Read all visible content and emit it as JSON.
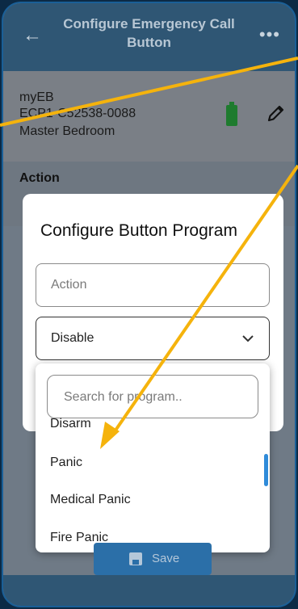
{
  "header": {
    "title": "Configure Emergency Call Button",
    "back_icon": "arrow-left-icon",
    "menu_icon": "more-dots-icon"
  },
  "device": {
    "name": "myEB",
    "serial": "ECP1-C52538-0088",
    "location": "Master Bedroom",
    "battery_icon": "battery-full-icon",
    "edit_icon": "pencil-icon"
  },
  "section": {
    "action_label": "Action"
  },
  "modal": {
    "title": "Configure Button Program",
    "action_placeholder": "Action",
    "selected_value": "Disable"
  },
  "dropdown": {
    "search_placeholder": "Search for program..",
    "options": [
      "Disarm",
      "Panic",
      "Medical Panic",
      "Fire Panic"
    ]
  },
  "footer": {
    "save_label": "Save"
  },
  "colors": {
    "header_bg": "#2f5674",
    "accent_blue": "#2f8bd9",
    "annotation_arrow": "#f5b30c",
    "battery_green": "#1e7b2e"
  }
}
